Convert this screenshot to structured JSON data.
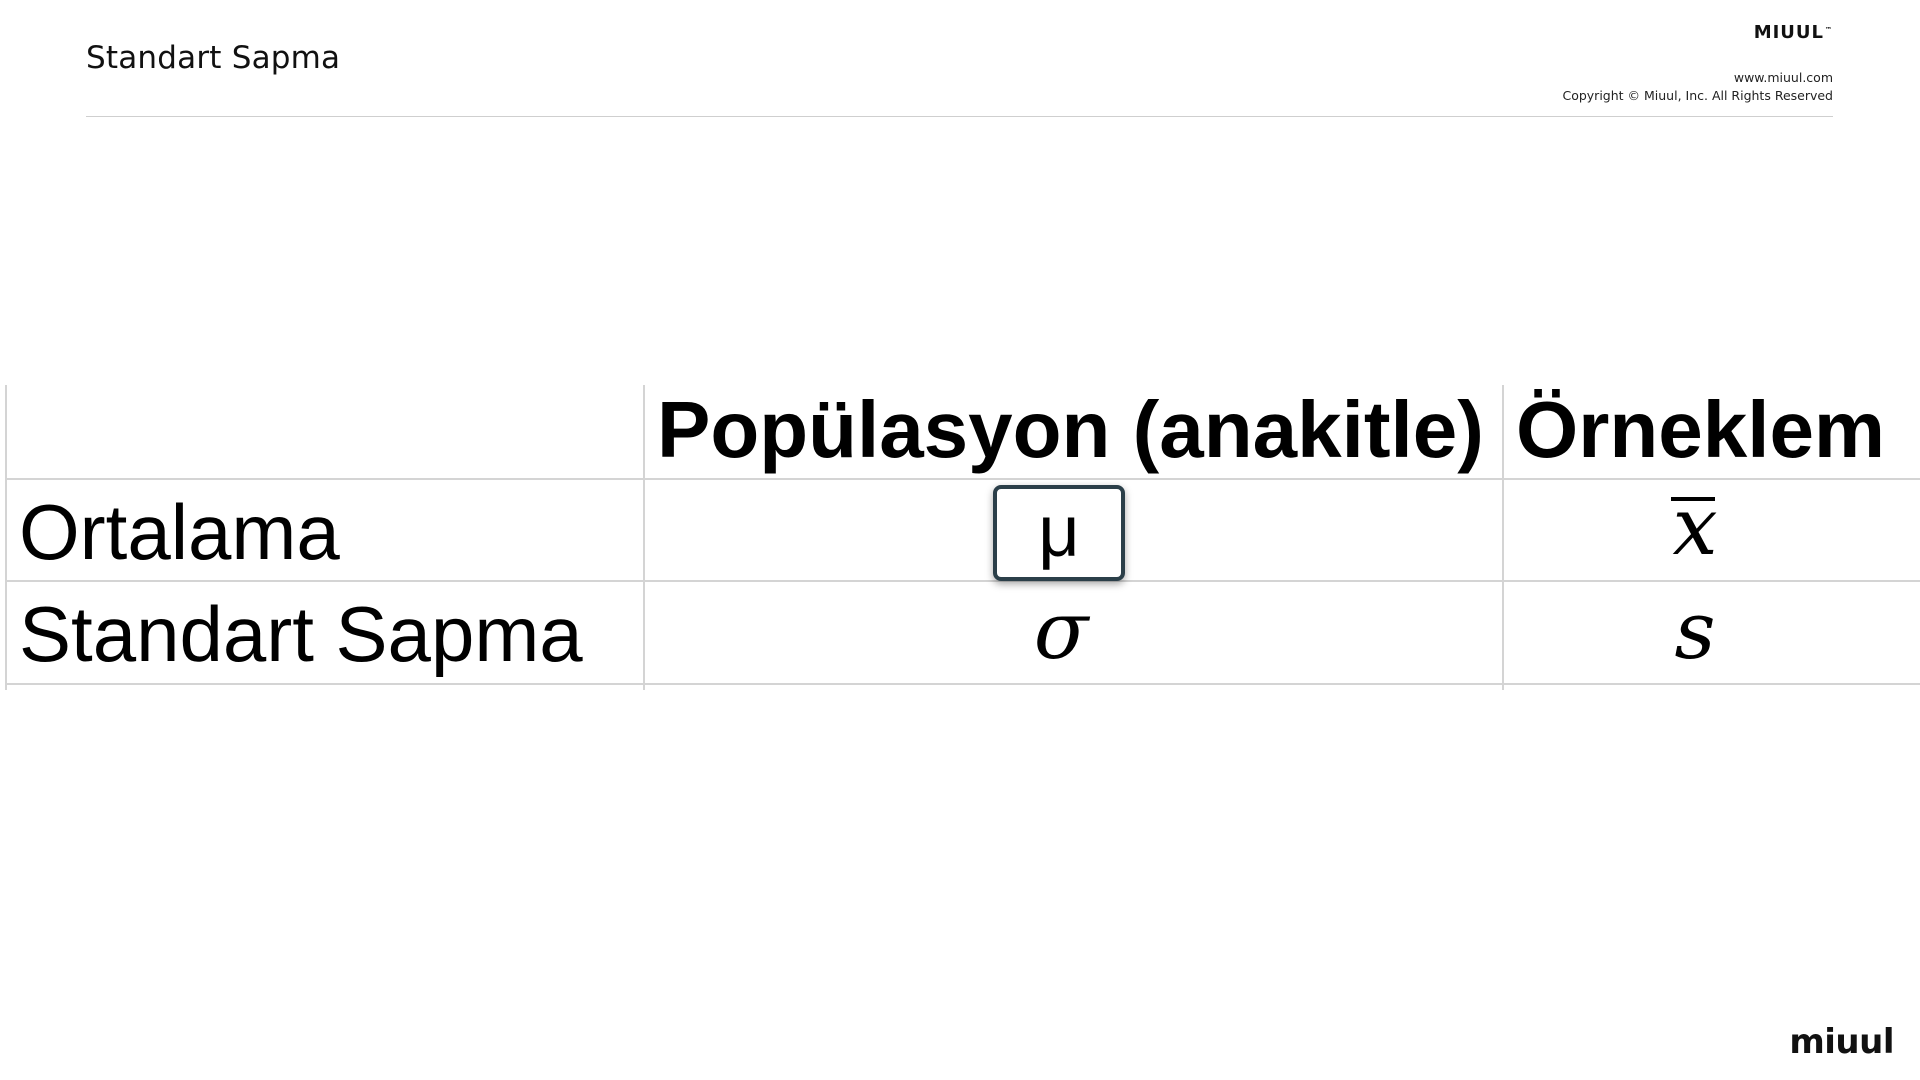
{
  "header": {
    "title": "Standart Sapma",
    "brand": "MIUUL",
    "brand_tm": "™",
    "url": "www.miuul.com",
    "copyright": "Copyright © Miuul, Inc. All Rights Reserved"
  },
  "table": {
    "column_headers": [
      "",
      "Popülasyon (anakitle)",
      "Örneklem"
    ],
    "rows": [
      {
        "label": "Ortalama",
        "population_symbol": "μ",
        "sample_symbol": "x̄"
      },
      {
        "label": "Standart Sapma",
        "population_symbol": "σ",
        "sample_symbol": "s"
      }
    ],
    "highlighted_cell": "μ"
  },
  "footer": {
    "logo_text": "miuul"
  }
}
